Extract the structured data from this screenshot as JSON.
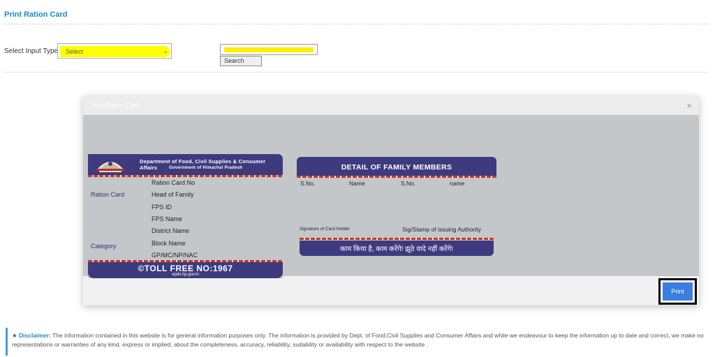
{
  "page": {
    "title": "Print Ration Card"
  },
  "form": {
    "input_type_label": "Select Input Type",
    "select_value": "Select",
    "search_button": "Search"
  },
  "modal": {
    "title": "Print Ration Card",
    "close_symbol": "×",
    "print_button": "Print"
  },
  "card_front": {
    "department": "Department of Food, Civil Supplies & Consumer Affairs",
    "government": "Government of Himachal Pradesh",
    "ration_card_label": "Ration Card",
    "category_label": "Category",
    "fields": [
      "Ration Card No",
      "Head of Family",
      "FPS ID",
      "FPS Name",
      "District Name",
      "Block Name",
      "GP/MC/NP/NAC"
    ],
    "toll_free": "©TOLL FREE NO:1967",
    "website": "epds.hp.gov.in"
  },
  "card_back": {
    "title": "DETAIL OF FAMILY MEMBERS",
    "columns": [
      "S.No.",
      "Name",
      "S.No.",
      "name"
    ],
    "signature_holder": "Signature of Card Holder",
    "signature_authority": "Sig/Stamp of issuing Authority",
    "slogan": "काम किया है, काम करेंगे! झूठे वादे नहीं करेंगे!"
  },
  "disclaimer": {
    "label": "Disclaimer:",
    "text": "The information contained in this website is for general information purposes only. The information is provided by Dept. of Food,Civil Supplies and Consumer Affairs and while we endeavour to keep the information up to date and correct, we make no representations or warranties of any kind, express or implied, about the completeness, accuracy, reliability, suitability or availability with respect to the website ."
  },
  "colors": {
    "accent": "#1e88c7",
    "card_purple": "#3d3a7e",
    "highlight_yellow": "#ffff00",
    "print_blue": "#3b7de0"
  }
}
